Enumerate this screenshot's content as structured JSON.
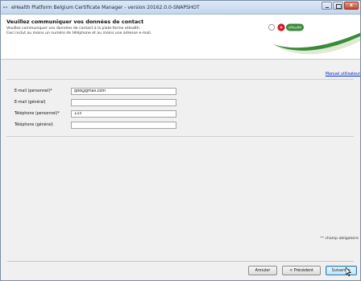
{
  "window": {
    "title": "eHealth Platform Belgium Certificate Manager - version 20162.0.0-SNAPSHOT",
    "controls": [
      "minimize",
      "maximize",
      "close"
    ]
  },
  "header": {
    "title": "Veuillez communiquer vos données de contact",
    "line1": "Veuillez communiquer vos données de contact à la plate-forme eHealth.",
    "line2": "Ceci inclut au moins un numéro de téléphone et au moins une adresse e-mail.",
    "logo_text": "eHealth",
    "logo_colors": {
      "green": "#3a8a3a",
      "red": "#d11a2a",
      "light_green": "#dfead0"
    }
  },
  "manual_link": "Manuel utilisateur",
  "form": {
    "fields": [
      {
        "label": "E-mail (personnel)*",
        "value": "qdd@gmail.com"
      },
      {
        "label": "E-mail (général)",
        "value": ""
      },
      {
        "label": "Téléphone (personnel)*",
        "value": "133"
      },
      {
        "label": "Téléphone (général)",
        "value": ""
      }
    ]
  },
  "required_note": "'*' champ obligatoire",
  "buttons": {
    "cancel": "Annuler",
    "previous": "< Précédent",
    "next": "Suivant >"
  }
}
